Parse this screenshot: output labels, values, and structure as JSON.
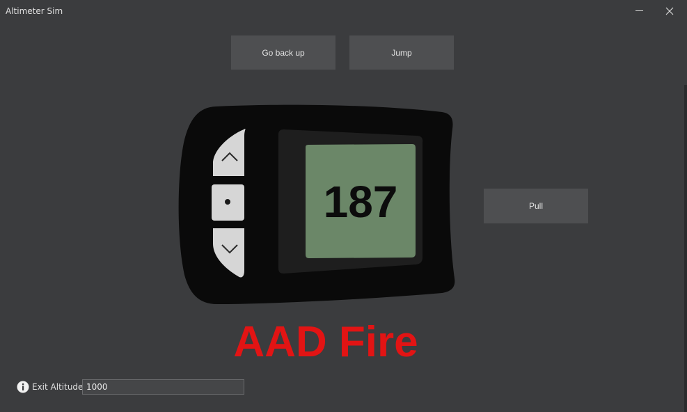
{
  "window": {
    "title": "Altimeter Sim",
    "minimize_icon": "minimize-icon",
    "close_icon": "close-icon"
  },
  "controls": {
    "back_label": "Go back up",
    "jump_label": "Jump",
    "pull_label": "Pull"
  },
  "altimeter": {
    "reading": "187",
    "screen_color": "#6b8768",
    "body_color": "#0a0a0a",
    "bezel_color": "#1e1e1e",
    "buttons": [
      {
        "name": "up-arrow-icon"
      },
      {
        "name": "dot-icon"
      },
      {
        "name": "down-arrow-icon"
      }
    ]
  },
  "status": {
    "text": "AAD Fire",
    "color": "#e21414"
  },
  "exit_altitude": {
    "label": "Exit Altitude:",
    "value": "1000",
    "icon": "info-icon"
  }
}
